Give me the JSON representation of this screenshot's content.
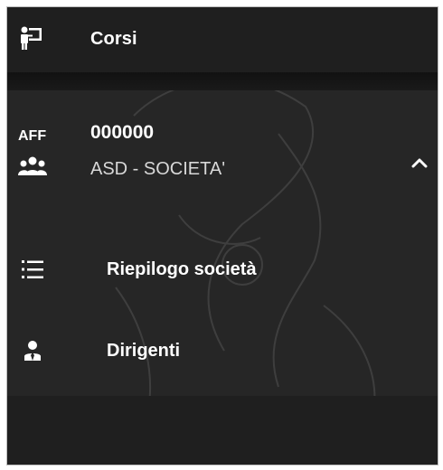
{
  "top_item": {
    "label": "Corsi",
    "icon": "presenter-board-icon"
  },
  "society": {
    "prefix": "AFF",
    "code": "000000",
    "name": "ASD - SOCIETA'",
    "icon": "people-group-icon",
    "expanded": true
  },
  "submenu": [
    {
      "label": "Riepilogo società",
      "icon": "list-icon"
    },
    {
      "label": "Dirigenti",
      "icon": "person-tie-icon"
    }
  ],
  "colors": {
    "background": "#262626",
    "text": "#ffffff",
    "muted": "#d8d8d8"
  }
}
